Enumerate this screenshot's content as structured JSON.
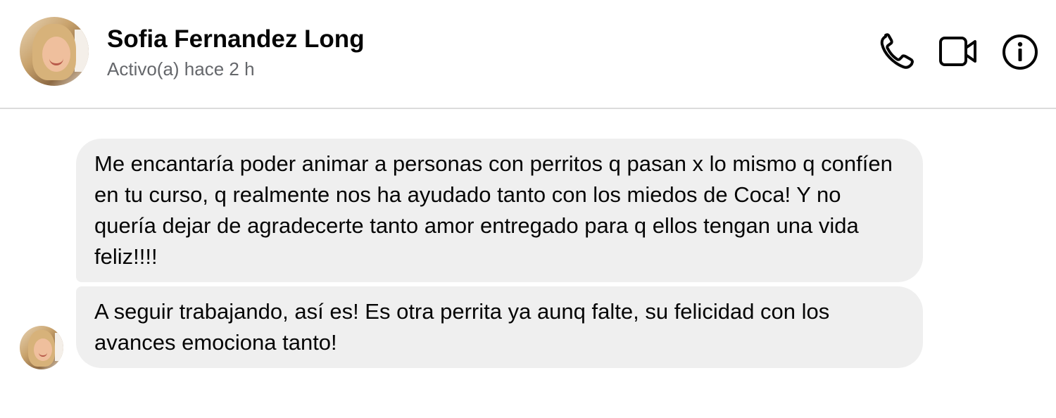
{
  "header": {
    "contact_name": "Sofia Fernandez Long",
    "status": "Activo(a) hace 2 h",
    "avatar_icon": "contact-avatar",
    "actions": [
      {
        "icon": "phone-icon"
      },
      {
        "icon": "video-camera-icon"
      },
      {
        "icon": "info-icon"
      }
    ]
  },
  "messages": [
    {
      "text": "Me encantaría poder animar a personas con perritos q pasan x lo mismo q confíen en tu curso, q realmente nos ha ayudado tanto con los miedos de Coca! Y no quería dejar de agradecerte tanto amor entregado para q ellos tengan una vida feliz!!!!"
    },
    {
      "text": "A seguir trabajando, así es! Es otra perrita ya aunq falte, su felicidad con los avances emociona tanto!"
    }
  ],
  "colors": {
    "bubble_background": "#efefef",
    "status_text": "#65676b",
    "divider": "#dcdcdc",
    "text": "#050505"
  }
}
